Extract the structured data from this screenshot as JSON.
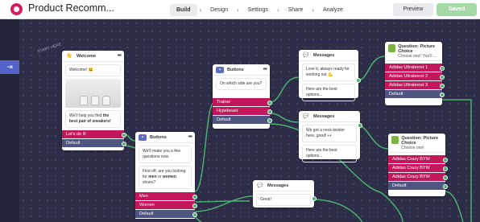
{
  "app": {
    "title": "Product Recomm..."
  },
  "steps": [
    "Build",
    "Design",
    "Settings",
    "Share",
    "Analyze"
  ],
  "actions": {
    "preview": "Preview",
    "saved": "Saved"
  },
  "canvas_note": "START HERE",
  "cards": {
    "welcome": {
      "title": "Welcome",
      "text1": "Welcome! 😃",
      "text2a": "We'll help you find ",
      "text2b": "the best pair of sneakers!",
      "opt1": "Let's do it!",
      "opt2": "Default"
    },
    "buttons1": {
      "title": "Buttons",
      "text1": "We'll make you a few questions now.",
      "text2a": "First off, are you looking for ",
      "text2b": "men",
      "text2c": " or ",
      "text2d": "women",
      "text2e": " shoes?",
      "opt1": "Men",
      "opt2": "Women",
      "opt3": "Default"
    },
    "buttons2": {
      "title": "Buttons",
      "text": "On which side are you?",
      "opt1": "Trainer",
      "opt2": "Hypebeast",
      "opt3": "Default"
    },
    "messages1": {
      "title": "Messages",
      "text1": "Love it, always ready for working out 💪",
      "text2": "Here are the best options..."
    },
    "messages2": {
      "title": "Messages",
      "text1": "We got a neck-twister here, good! 👀",
      "text2": "Here are the best options..."
    },
    "messages3": {
      "title": "Messages",
      "text": "Great!"
    },
    "question1": {
      "title": "Question: Picture Choice",
      "subtitle": "Choose one!' You'll ...",
      "opt1": "Adidas Ultraboost 1",
      "opt2": "Adidas Ultraboost 2",
      "opt3": "Adidas Ultraboost 3",
      "opt4": "Default"
    },
    "question2": {
      "title": "Question: Picture Choice",
      "subtitle": "Choose one!",
      "opt1": "Adidas Crazy BYW",
      "opt2": "Adidas Crazy BYW",
      "opt3": "Adidas Crazy BYW",
      "opt4": "Default"
    }
  },
  "colors": {
    "accent": "#c2185b",
    "default_option": "#4e5580",
    "wire": "#4caf73",
    "canvas": "#2d2d47"
  }
}
